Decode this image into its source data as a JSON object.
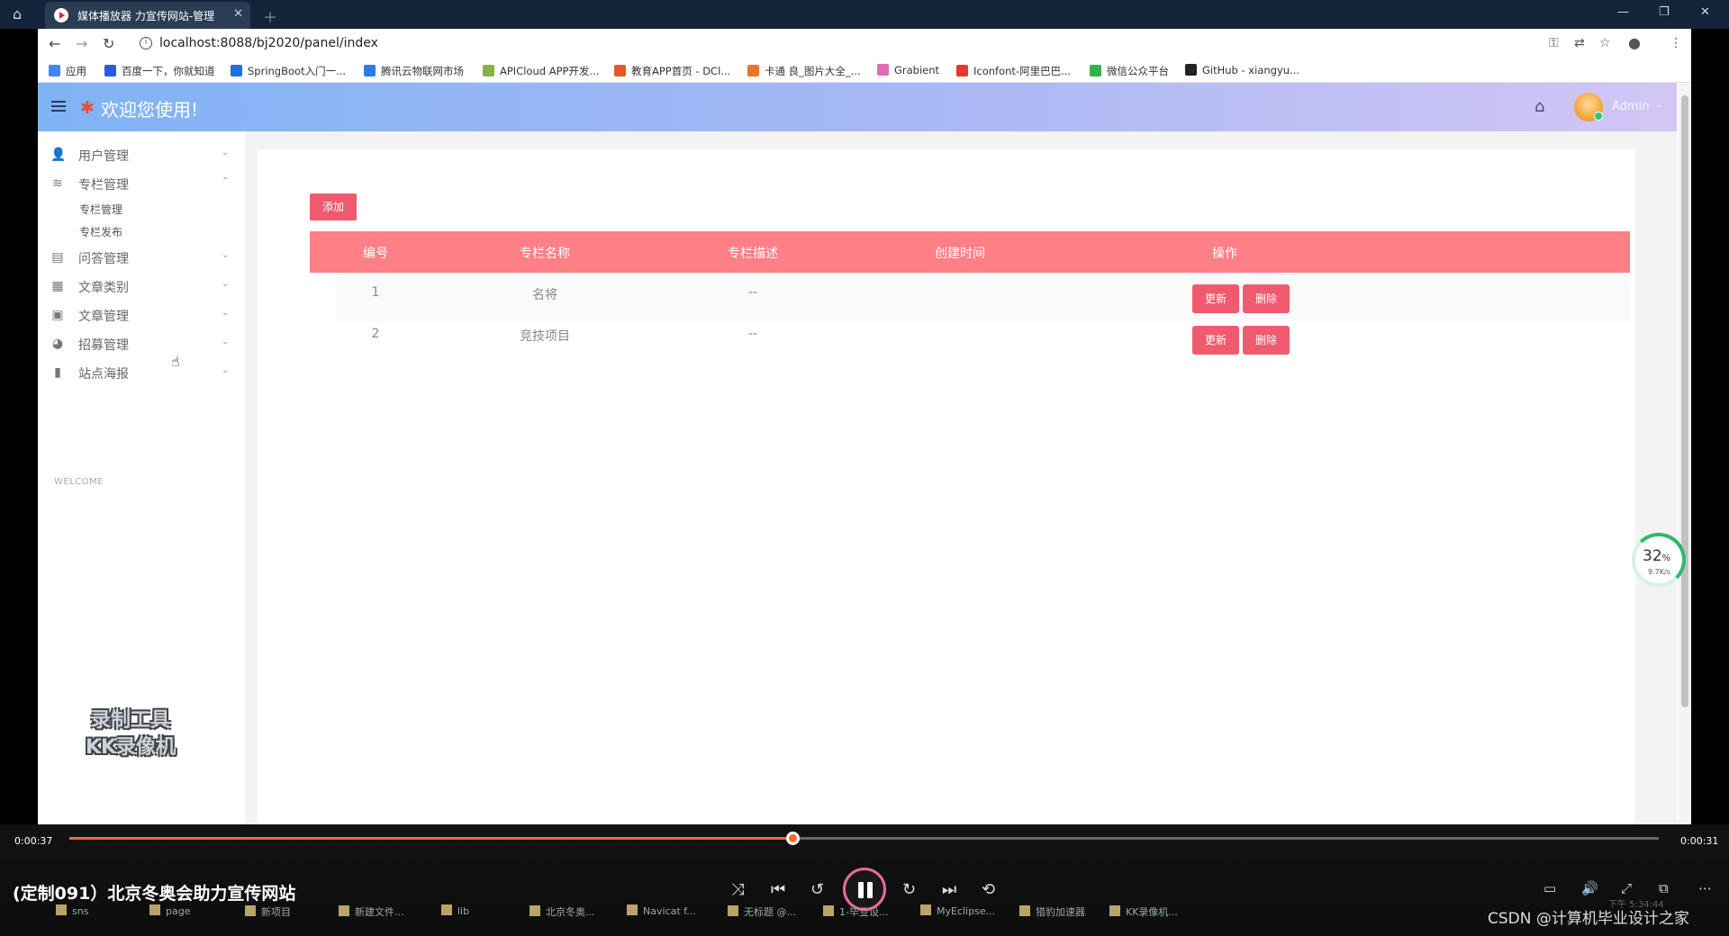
{
  "player": {
    "tab_title": "媒体播放器 力宣传网站-管理",
    "time_elapsed": "0:00:37",
    "time_total": "0:00:31",
    "progress_fraction": 0.455,
    "video_title": "(定制091）北京冬奥会助力宣传网站",
    "watermark_line1": "录制工具",
    "watermark_line2": "KK录像机",
    "csdn_watermark": "CSDN @计算机毕业设计之家",
    "clock": "下午 5:34:44"
  },
  "browser": {
    "url": "localhost:8088/bj2020/panel/index",
    "bookmarks": [
      {
        "label": "应用",
        "color": "#4285f4"
      },
      {
        "label": "百度一下，你就知道",
        "color": "#2b5bd7"
      },
      {
        "label": "SpringBoot入门一...",
        "color": "#1e6fd9"
      },
      {
        "label": "腾讯云物联网市场",
        "color": "#2a7de1"
      },
      {
        "label": "APICloud APP开发...",
        "color": "#8ab04a"
      },
      {
        "label": "教育APP首页 - DCl...",
        "color": "#e05a2b"
      },
      {
        "label": "卡通 良_图片大全_...",
        "color": "#e8732a"
      },
      {
        "label": "Grabient",
        "color": "#e36bb0"
      },
      {
        "label": "Iconfont-阿里巴巴...",
        "color": "#e5392f"
      },
      {
        "label": "微信公众平台",
        "color": "#2eb34a"
      },
      {
        "label": "GitHub - xiangyu...",
        "color": "#222222"
      }
    ]
  },
  "app": {
    "title": "欢迎您使用!",
    "user": "Admin",
    "welcome": "WELCOME",
    "menu": [
      {
        "label": "用户管理",
        "icon": "user-icon",
        "glyph": "👤"
      },
      {
        "label": "专栏管理",
        "icon": "layers-icon",
        "glyph": "≋"
      },
      {
        "label": "问答管理",
        "icon": "files-icon",
        "glyph": "▤"
      },
      {
        "label": "文章类别",
        "icon": "list-icon",
        "glyph": "▦"
      },
      {
        "label": "文章管理",
        "icon": "doc-icon",
        "glyph": "▣"
      },
      {
        "label": "招募管理",
        "icon": "pie-icon",
        "glyph": "◕"
      },
      {
        "label": "站点海报",
        "icon": "bar-chart-icon",
        "glyph": "▮"
      }
    ],
    "submenu": [
      "专栏管理",
      "专栏发布"
    ],
    "add_label": "添加",
    "columns": [
      "编号",
      "专栏名称",
      "专栏描述",
      "创建时间",
      "操作"
    ],
    "rows": [
      {
        "id": "1",
        "name": "名将",
        "desc": "--",
        "created": ""
      },
      {
        "id": "2",
        "name": "竞技项目",
        "desc": "--",
        "created": ""
      }
    ],
    "update_label": "更新",
    "delete_label": "删除",
    "accent": "#f05a6e",
    "header_color": "#ff7f87"
  },
  "speed_widget": {
    "percent": "32",
    "unit": "%",
    "rate": "9.7K/s"
  },
  "taskbar": [
    {
      "label": "sns"
    },
    {
      "label": "page"
    },
    {
      "label": "新项目"
    },
    {
      "label": "新建文件..."
    },
    {
      "label": "lib"
    },
    {
      "label": "北京冬奥..."
    },
    {
      "label": "Navicat f..."
    },
    {
      "label": "无标题 @..."
    },
    {
      "label": "1-毕业设..."
    },
    {
      "label": "MyEclipse..."
    },
    {
      "label": "猎豹加速器"
    },
    {
      "label": "KK录像机..."
    }
  ]
}
